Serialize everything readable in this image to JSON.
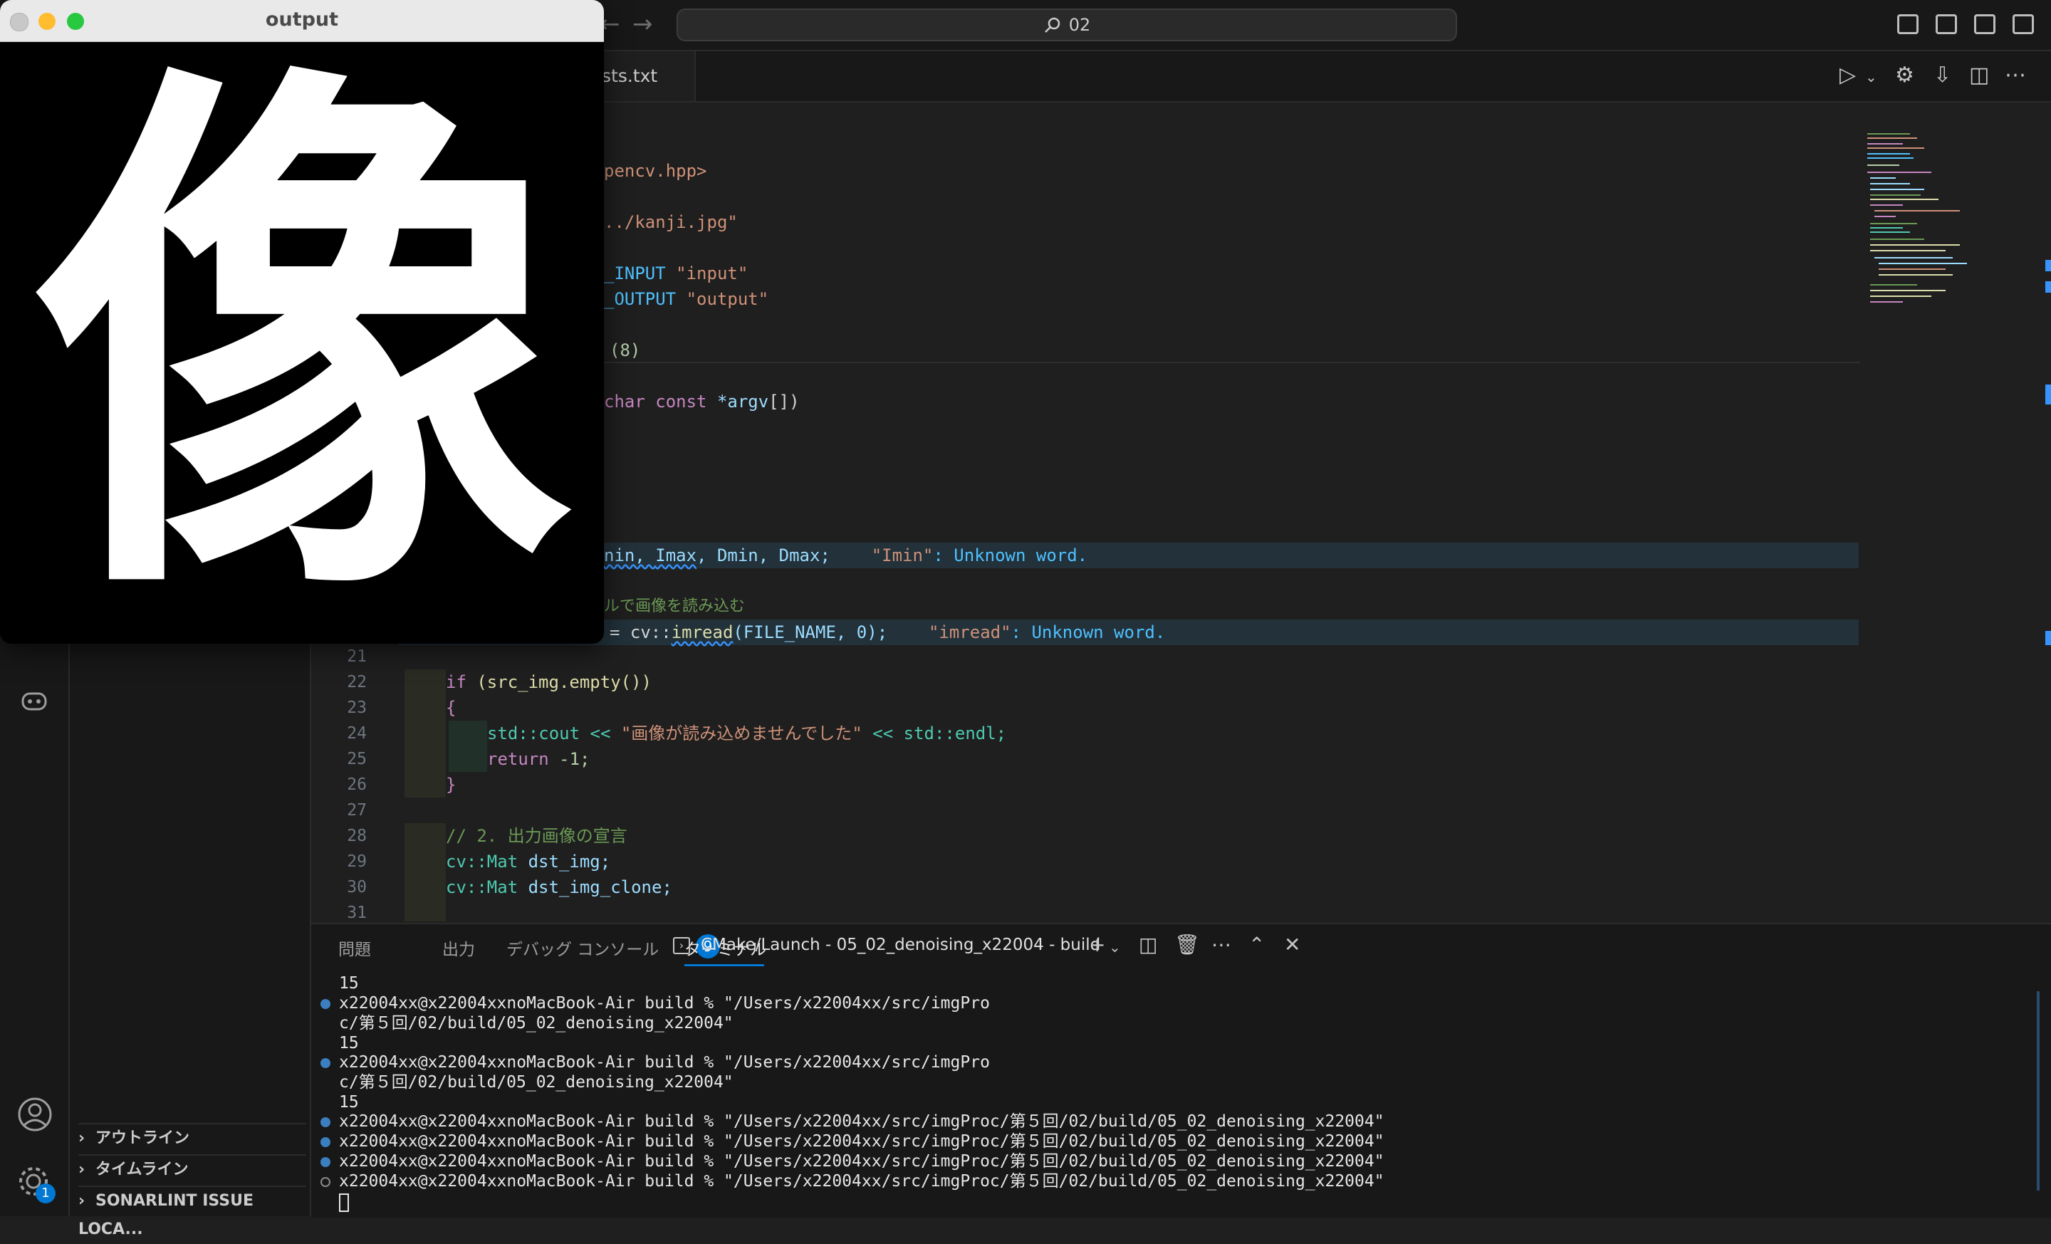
{
  "titlebar": {
    "search_text": "02"
  },
  "tab": {
    "label": "sts.txt"
  },
  "sidebar": {
    "sections": [
      {
        "label": "アウトライン"
      },
      {
        "label": "タイムライン"
      },
      {
        "label": "SONARLINT ISSUE LOCA..."
      }
    ],
    "account_badge": "1"
  },
  "editor": {
    "line_numbers": [
      "21",
      "22",
      "23",
      "24",
      "25",
      "26",
      "27",
      "28",
      "29",
      "30",
      "31"
    ],
    "code": {
      "inc": "pencv.hpp>",
      "file": "../kanji.jpg\"",
      "win_in_a": "_INPUT ",
      "win_in_b": "\"input\"",
      "win_out_a": "_OUTPUT ",
      "win_out_b": "\"output\"",
      "num8": "(8)",
      "main_a": "char const ",
      "main_b": "*argv",
      "main_c": "[])",
      "decl_a": "nin, ",
      "decl_b": "Imax",
      "decl_c": ", Dmin, Dmax;",
      "hint1_q": "\"Imin\"",
      "hint1_t": ": Unknown word.",
      "comment_read": "ルで画像を読み込む",
      "read_a": "= cv::",
      "read_b": "imread",
      "read_c": "(FILE_NAME, 0);",
      "hint2_q": "\"imread\"",
      "hint2_t": ": Unknown word.",
      "l22_kw": "if",
      "l22_rest": " (src_img.empty())",
      "l23": "{",
      "l24_a": "std::cout << ",
      "l24_str": "\"画像が読み込めませんでした\"",
      "l24_b": " << std::endl;",
      "l25_kw": "return",
      "l25_num": " -1;",
      "l26": "}",
      "l28": "// 2. 出力画像の宣言",
      "l29_a": "cv::",
      "l29_b": "Mat",
      "l29_c": " dst_img;",
      "l30_a": "cv::",
      "l30_b": "Mat",
      "l30_c": " dst_img_clone;"
    }
  },
  "panel": {
    "tabs": [
      "問題",
      "出力",
      "デバッグ コンソール",
      "ターミナル"
    ],
    "problems_count": "9",
    "terminal_name": "CMake/Launch - 05_02_denoising_x22004 - build",
    "terminal_lines": [
      "15",
      "x22004xx@x22004xxnoMacBook-Air build % \"/Users/x22004xx/src/imgPro",
      "c/第５回/02/build/05_02_denoising_x22004\"",
      "15",
      "x22004xx@x22004xxnoMacBook-Air build % \"/Users/x22004xx/src/imgPro",
      "c/第５回/02/build/05_02_denoising_x22004\"",
      "15",
      "x22004xx@x22004xxnoMacBook-Air build % \"/Users/x22004xx/src/imgProc/第５回/02/build/05_02_denoising_x22004\"",
      "x22004xx@x22004xxnoMacBook-Air build % \"/Users/x22004xx/src/imgProc/第５回/02/build/05_02_denoising_x22004\"",
      "x22004xx@x22004xxnoMacBook-Air build % \"/Users/x22004xx/src/imgProc/第５回/02/build/05_02_denoising_x22004\"",
      "x22004xx@x22004xxnoMacBook-Air build % \"/Users/x22004xx/src/imgProc/第５回/02/build/05_02_denoising_x22004\""
    ]
  },
  "output_window": {
    "title": "output",
    "kanji": "像"
  },
  "colors": {
    "accent": "#0078d4",
    "editor_bg": "#1f1f1f",
    "chrome_bg": "#181818"
  },
  "icons": [
    "search-icon",
    "run-icon",
    "gear-icon",
    "copilot-icon",
    "account-icon",
    "manage-gear-icon",
    "split-icon",
    "trash-icon",
    "close-icon",
    "maximize-icon",
    "add-terminal-icon",
    "more-icon"
  ]
}
